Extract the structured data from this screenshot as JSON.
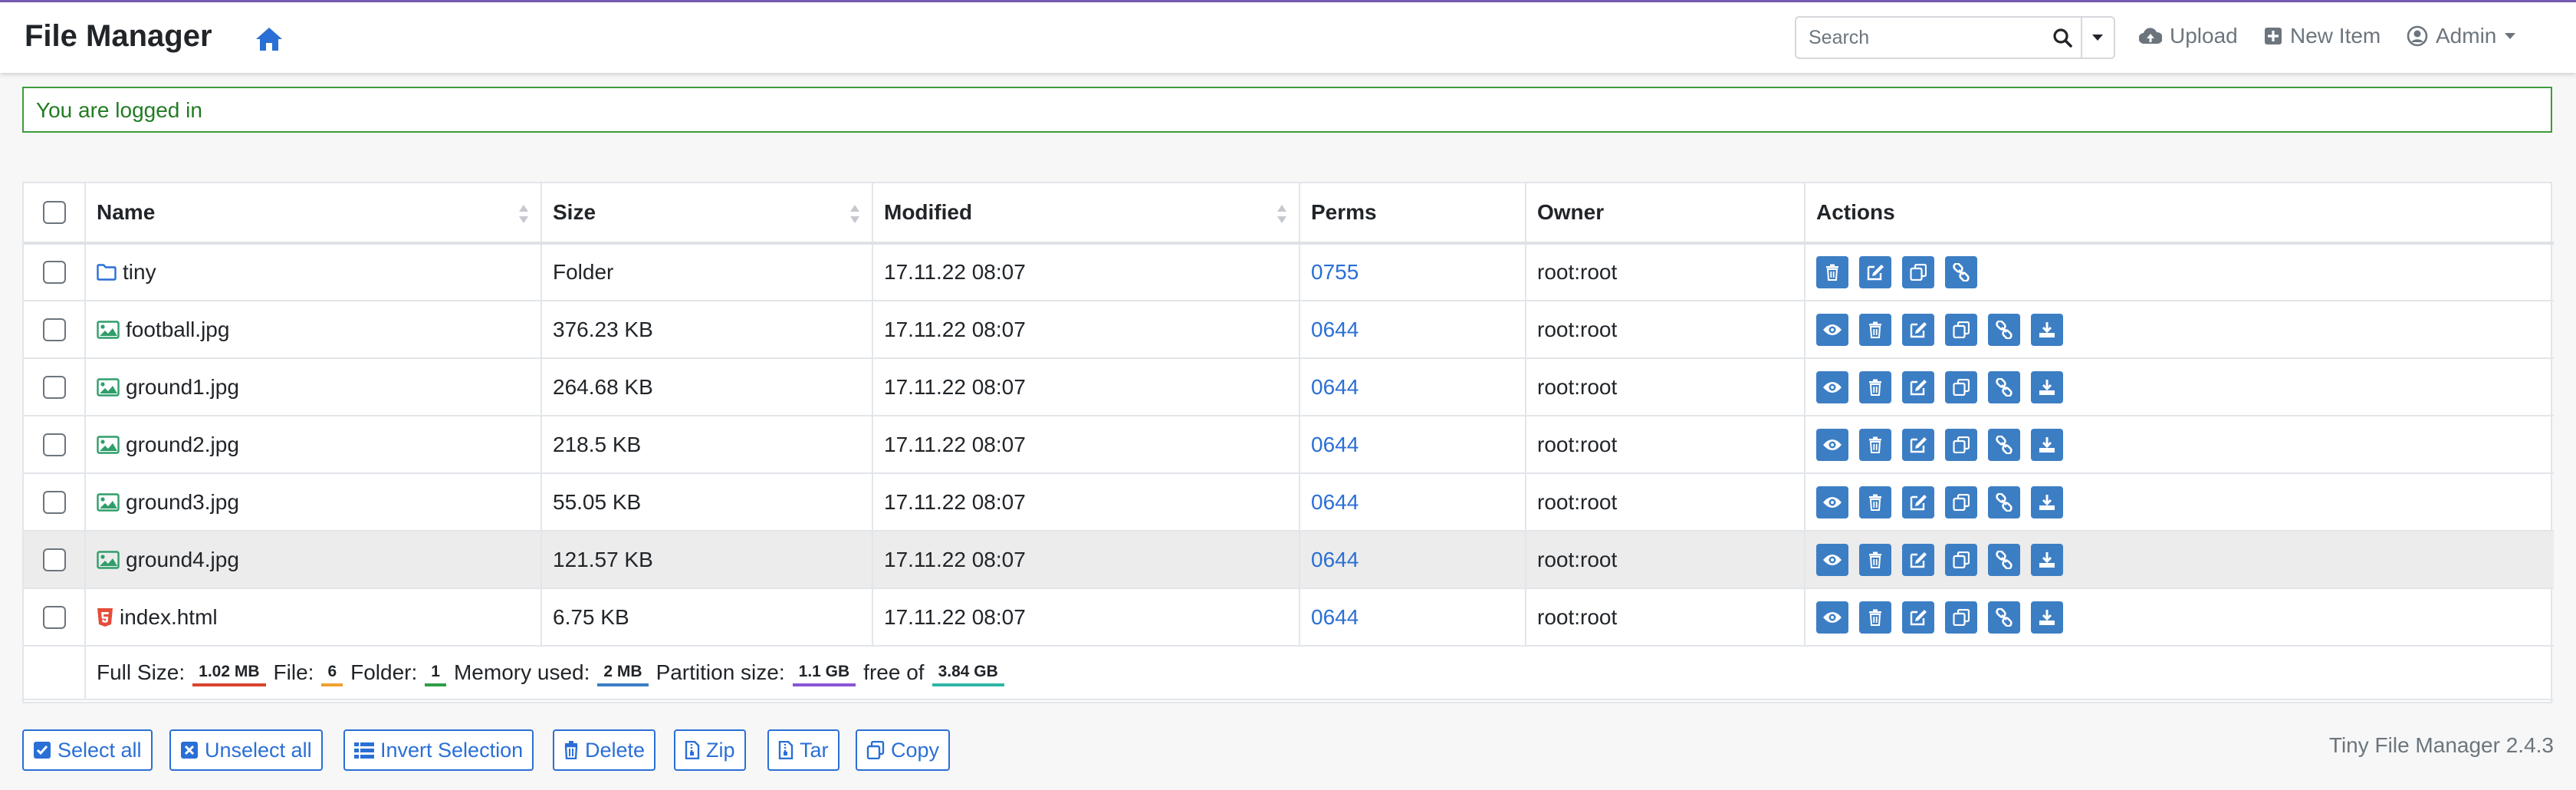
{
  "header": {
    "brand": "File Manager",
    "search_placeholder": "Search",
    "upload_label": "Upload",
    "new_item_label": "New Item",
    "admin_label": "Admin"
  },
  "alert": {
    "message": "You are logged in"
  },
  "table": {
    "columns": [
      "Name",
      "Size",
      "Modified",
      "Perms",
      "Owner",
      "Actions"
    ],
    "rows": [
      {
        "name": "tiny",
        "icon": "folder-icon",
        "size": "Folder",
        "modified": "17.11.22 08:07",
        "perms": "0755",
        "owner": "root:root",
        "actions": [
          "delete",
          "rename",
          "copy",
          "link"
        ]
      },
      {
        "name": "football.jpg",
        "icon": "image-icon",
        "size": "376.23 KB",
        "modified": "17.11.22 08:07",
        "perms": "0644",
        "owner": "root:root",
        "actions": [
          "view",
          "delete",
          "rename",
          "copy",
          "link",
          "download"
        ]
      },
      {
        "name": "ground1.jpg",
        "icon": "image-icon",
        "size": "264.68 KB",
        "modified": "17.11.22 08:07",
        "perms": "0644",
        "owner": "root:root",
        "actions": [
          "view",
          "delete",
          "rename",
          "copy",
          "link",
          "download"
        ]
      },
      {
        "name": "ground2.jpg",
        "icon": "image-icon",
        "size": "218.5 KB",
        "modified": "17.11.22 08:07",
        "perms": "0644",
        "owner": "root:root",
        "actions": [
          "view",
          "delete",
          "rename",
          "copy",
          "link",
          "download"
        ]
      },
      {
        "name": "ground3.jpg",
        "icon": "image-icon",
        "size": "55.05 KB",
        "modified": "17.11.22 08:07",
        "perms": "0644",
        "owner": "root:root",
        "actions": [
          "view",
          "delete",
          "rename",
          "copy",
          "link",
          "download"
        ]
      },
      {
        "name": "ground4.jpg",
        "icon": "image-icon",
        "size": "121.57 KB",
        "modified": "17.11.22 08:07",
        "perms": "0644",
        "owner": "root:root",
        "actions": [
          "view",
          "delete",
          "rename",
          "copy",
          "link",
          "download"
        ],
        "highlighted": true
      },
      {
        "name": "index.html",
        "icon": "html5-icon",
        "size": "6.75 KB",
        "modified": "17.11.22 08:07",
        "perms": "0644",
        "owner": "root:root",
        "actions": [
          "view",
          "delete",
          "rename",
          "copy",
          "link",
          "download"
        ]
      }
    ]
  },
  "summary": {
    "full_size_label": "Full Size:",
    "full_size": "1.02 MB",
    "file_label": "File:",
    "file_count": "6",
    "folder_label": "Folder:",
    "folder_count": "1",
    "memory_label": "Memory used:",
    "memory": "2 MB",
    "partition_label": "Partition size:",
    "partition": "1.1 GB",
    "free_label": "free of",
    "total": "3.84 GB"
  },
  "buttons": {
    "select_all": "Select all",
    "unselect_all": "Unselect all",
    "invert": "Invert Selection",
    "delete": "Delete",
    "zip": "Zip",
    "tar": "Tar",
    "copy": "Copy"
  },
  "version": "Tiny File Manager 2.4.3",
  "colors": {
    "accent": "#2a6fd6",
    "action_button": "#3c7ec4",
    "alert_border": "#3d9b3d",
    "top_line": "#7a5bb5"
  }
}
